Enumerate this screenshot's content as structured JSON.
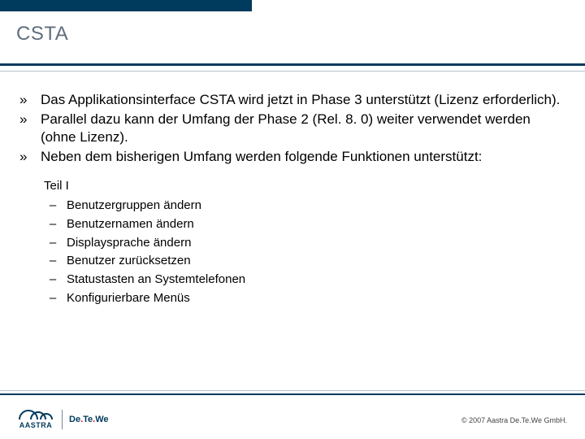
{
  "title": "CSTA",
  "bullets": [
    "Das Applikationsinterface CSTA wird jetzt in Phase 3 unterstützt (Lizenz erforderlich).",
    "Parallel dazu kann der Umfang der Phase 2 (Rel. 8. 0) weiter verwendet werden (ohne Lizenz).",
    "Neben dem bisherigen Umfang werden folgende Funktionen unterstützt:"
  ],
  "part_label": "Teil I",
  "dash_items": [
    "Benutzergruppen ändern",
    "Benutzernamen ändern",
    "Displaysprache ändern",
    "Benutzer zurücksetzen",
    "Statustasten an Systemtelefonen",
    "Konfigurierbare Menüs"
  ],
  "logo": {
    "brand_a": "AASTRA",
    "brand_b_pre": "De",
    "brand_b_dot": ".",
    "brand_b_mid": "Te",
    "brand_b_dot2": ".",
    "brand_b_post": "We"
  },
  "footer": {
    "copyright": "© 2007 Aastra De.Te.We GmbH."
  },
  "marks": {
    "raquo": "»",
    "dash": "–"
  }
}
